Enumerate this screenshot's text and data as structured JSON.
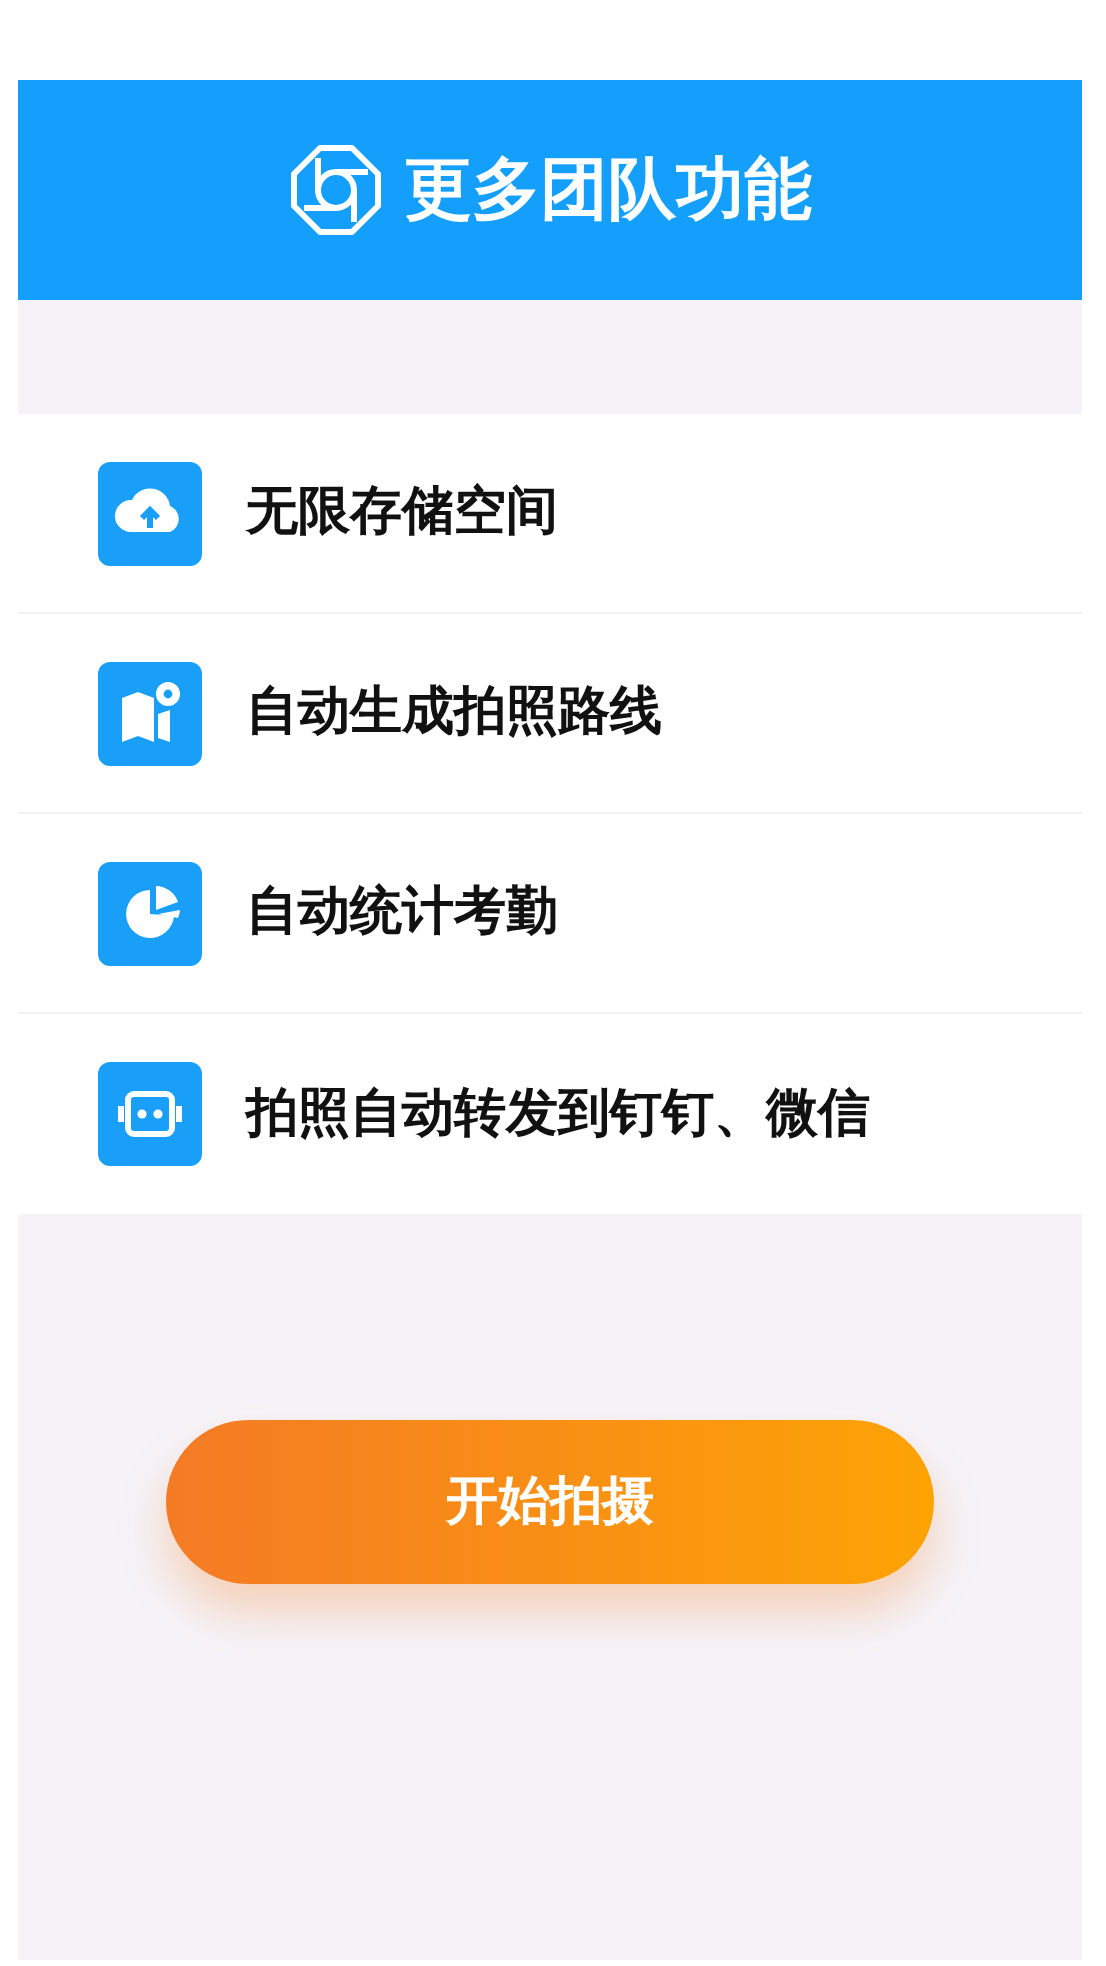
{
  "header": {
    "title": "更多团队功能"
  },
  "features": [
    {
      "kind": "cloud",
      "label": "无限存储空间"
    },
    {
      "kind": "map",
      "label": "自动生成拍照路线"
    },
    {
      "kind": "chart",
      "label": "自动统计考勤"
    },
    {
      "kind": "robot",
      "label": "拍照自动转发到钉钉、微信"
    }
  ],
  "start_button": {
    "label": "开始拍摄"
  }
}
